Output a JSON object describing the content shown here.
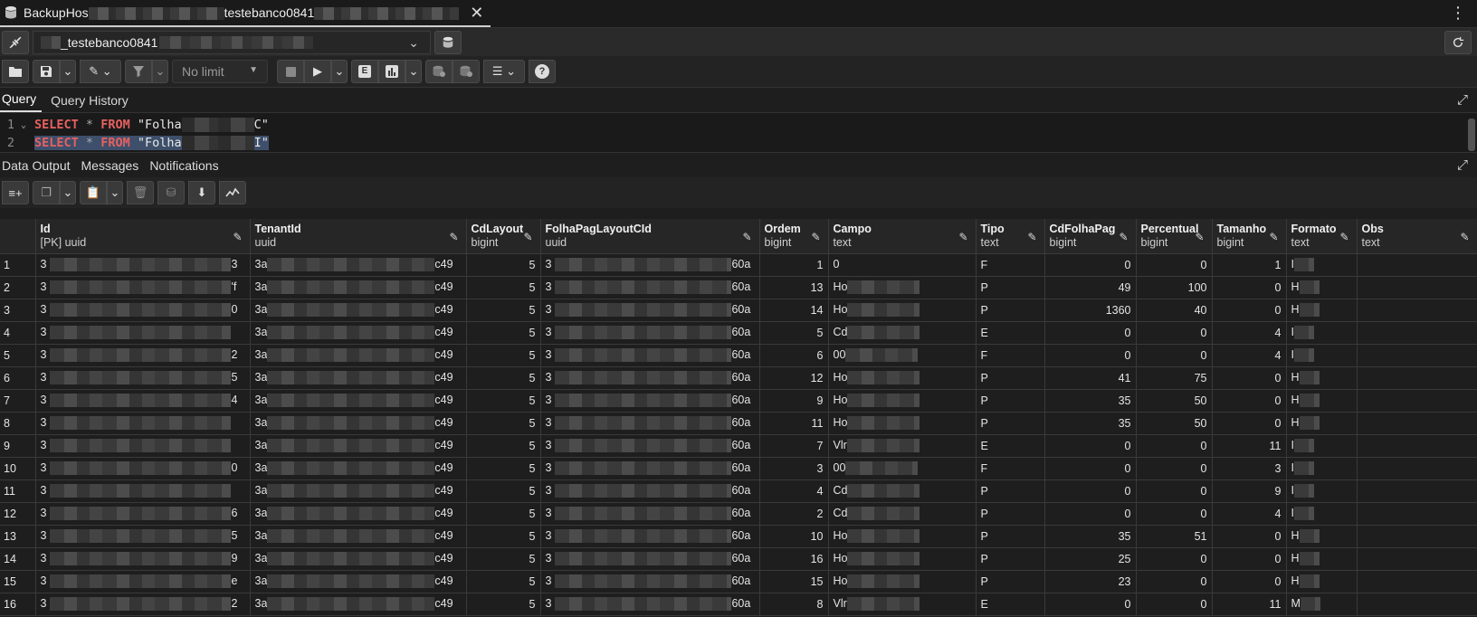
{
  "tab": {
    "title_prefix": "BackupHos",
    "title_mid": "testebanco0841",
    "close": "✕"
  },
  "connection": {
    "label_prefix": "_testebanco0841"
  },
  "toolbar": {
    "limit_label": "No limit"
  },
  "query_tabs": [
    "Query",
    "Query History"
  ],
  "editor": {
    "lines": [
      {
        "num": "1",
        "kw1": "SELECT",
        "op": "*",
        "kw2": "FROM",
        "str_start": "\"Folha",
        "str_end": "C\""
      },
      {
        "num": "2",
        "kw1": "SELECT",
        "op": "*",
        "kw2": "FROM",
        "str_start": "\"Folha",
        "str_end": "I\""
      }
    ]
  },
  "output_tabs": [
    "Data Output",
    "Messages",
    "Notifications"
  ],
  "columns": [
    {
      "name": "Id",
      "type": "[PK] uuid"
    },
    {
      "name": "TenantId",
      "type": "uuid"
    },
    {
      "name": "CdLayout",
      "type": "bigint"
    },
    {
      "name": "FolhaPagLayoutCId",
      "type": "uuid"
    },
    {
      "name": "Ordem",
      "type": "bigint"
    },
    {
      "name": "Campo",
      "type": "text"
    },
    {
      "name": "Tipo",
      "type": "text"
    },
    {
      "name": "CdFolhaPag",
      "type": "bigint"
    },
    {
      "name": "Percentual",
      "type": "bigint"
    },
    {
      "name": "Tamanho",
      "type": "bigint"
    },
    {
      "name": "Formato",
      "type": "text"
    },
    {
      "name": "Obs",
      "type": "text"
    }
  ],
  "rows": [
    {
      "n": "1",
      "id_s": "3",
      "id_e": "3",
      "ten_s": "3a",
      "ten_e": "c49",
      "cd": "5",
      "flc_s": "3",
      "flc_e": "60a",
      "ordem": "1",
      "campo": "0",
      "tipo": "F",
      "cdfp": "0",
      "perc": "0",
      "tam": "1",
      "fmt": "I"
    },
    {
      "n": "2",
      "id_s": "3",
      "id_e": "'f",
      "ten_s": "3a",
      "ten_e": "c49",
      "cd": "5",
      "flc_s": "3",
      "flc_e": "60a",
      "ordem": "13",
      "campo": "Ho",
      "tipo": "P",
      "cdfp": "49",
      "perc": "100",
      "tam": "0",
      "fmt": "H"
    },
    {
      "n": "3",
      "id_s": "3",
      "id_e": "0",
      "ten_s": "3a",
      "ten_e": "c49",
      "cd": "5",
      "flc_s": "3",
      "flc_e": "60a",
      "ordem": "14",
      "campo": "Ho",
      "tipo": "P",
      "cdfp": "1360",
      "perc": "40",
      "tam": "0",
      "fmt": "H"
    },
    {
      "n": "4",
      "id_s": "3",
      "id_e": "",
      "ten_s": "3a",
      "ten_e": "c49",
      "cd": "5",
      "flc_s": "3",
      "flc_e": "60a",
      "ordem": "5",
      "campo": "Cd",
      "tipo": "E",
      "cdfp": "0",
      "perc": "0",
      "tam": "4",
      "fmt": "I"
    },
    {
      "n": "5",
      "id_s": "3",
      "id_e": "2",
      "ten_s": "3a",
      "ten_e": "c49",
      "cd": "5",
      "flc_s": "3",
      "flc_e": "60a",
      "ordem": "6",
      "campo": "00",
      "tipo": "F",
      "cdfp": "0",
      "perc": "0",
      "tam": "4",
      "fmt": "I"
    },
    {
      "n": "6",
      "id_s": "3",
      "id_e": "5",
      "ten_s": "3a",
      "ten_e": "c49",
      "cd": "5",
      "flc_s": "3",
      "flc_e": "60a",
      "ordem": "12",
      "campo": "Ho",
      "tipo": "P",
      "cdfp": "41",
      "perc": "75",
      "tam": "0",
      "fmt": "H"
    },
    {
      "n": "7",
      "id_s": "3",
      "id_e": "4",
      "ten_s": "3a",
      "ten_e": "c49",
      "cd": "5",
      "flc_s": "3",
      "flc_e": "60a",
      "ordem": "9",
      "campo": "Ho",
      "tipo": "P",
      "cdfp": "35",
      "perc": "50",
      "tam": "0",
      "fmt": "H"
    },
    {
      "n": "8",
      "id_s": "3",
      "id_e": "",
      "ten_s": "3a",
      "ten_e": "c49",
      "cd": "5",
      "flc_s": "3",
      "flc_e": "60a",
      "ordem": "11",
      "campo": "Ho",
      "tipo": "P",
      "cdfp": "35",
      "perc": "50",
      "tam": "0",
      "fmt": "H"
    },
    {
      "n": "9",
      "id_s": "3",
      "id_e": "",
      "ten_s": "3a",
      "ten_e": "c49",
      "cd": "5",
      "flc_s": "3",
      "flc_e": "60a",
      "ordem": "7",
      "campo": "Vlr",
      "tipo": "E",
      "cdfp": "0",
      "perc": "0",
      "tam": "11",
      "fmt": "I"
    },
    {
      "n": "10",
      "id_s": "3",
      "id_e": "0",
      "ten_s": "3a",
      "ten_e": "c49",
      "cd": "5",
      "flc_s": "3",
      "flc_e": "60a",
      "ordem": "3",
      "campo": "00",
      "tipo": "F",
      "cdfp": "0",
      "perc": "0",
      "tam": "3",
      "fmt": "I"
    },
    {
      "n": "11",
      "id_s": "3",
      "id_e": "",
      "ten_s": "3a",
      "ten_e": "c49",
      "cd": "5",
      "flc_s": "3",
      "flc_e": "60a",
      "ordem": "4",
      "campo": "Cd",
      "tipo": "P",
      "cdfp": "0",
      "perc": "0",
      "tam": "9",
      "fmt": "I"
    },
    {
      "n": "12",
      "id_s": "3",
      "id_e": "6",
      "ten_s": "3a",
      "ten_e": "c49",
      "cd": "5",
      "flc_s": "3",
      "flc_e": "60a",
      "ordem": "2",
      "campo": "Cd",
      "tipo": "P",
      "cdfp": "0",
      "perc": "0",
      "tam": "4",
      "fmt": "I"
    },
    {
      "n": "13",
      "id_s": "3",
      "id_e": "5",
      "ten_s": "3a",
      "ten_e": "c49",
      "cd": "5",
      "flc_s": "3",
      "flc_e": "60a",
      "ordem": "10",
      "campo": "Ho",
      "tipo": "P",
      "cdfp": "35",
      "perc": "51",
      "tam": "0",
      "fmt": "H"
    },
    {
      "n": "14",
      "id_s": "3",
      "id_e": "9",
      "ten_s": "3a",
      "ten_e": "c49",
      "cd": "5",
      "flc_s": "3",
      "flc_e": "60a",
      "ordem": "16",
      "campo": "Ho",
      "tipo": "P",
      "cdfp": "25",
      "perc": "0",
      "tam": "0",
      "fmt": "H"
    },
    {
      "n": "15",
      "id_s": "3",
      "id_e": "e",
      "ten_s": "3a",
      "ten_e": "c49",
      "cd": "5",
      "flc_s": "3",
      "flc_e": "60a",
      "ordem": "15",
      "campo": "Ho",
      "tipo": "P",
      "cdfp": "23",
      "perc": "0",
      "tam": "0",
      "fmt": "H"
    },
    {
      "n": "16",
      "id_s": "3",
      "id_e": "2",
      "ten_s": "3a",
      "ten_e": "c49",
      "cd": "5",
      "flc_s": "3",
      "flc_e": "60a",
      "ordem": "8",
      "campo": "Vlr",
      "tipo": "E",
      "cdfp": "0",
      "perc": "0",
      "tam": "11",
      "fmt": "M"
    }
  ]
}
